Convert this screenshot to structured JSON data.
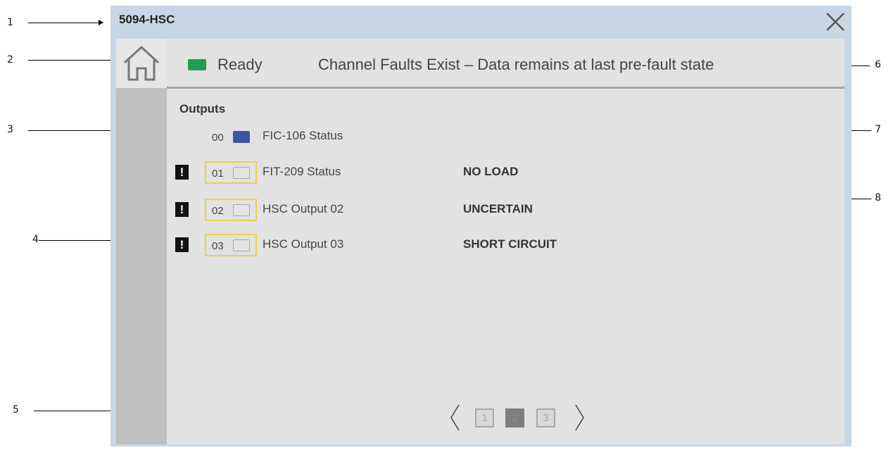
{
  "faceplate": {
    "title": "5094-HSC",
    "status": {
      "led_color": "#1f9e4f",
      "text": "Ready",
      "fault_message": "Channel Faults Exist – Data remains at last pre-fault state"
    },
    "section_label": "Outputs",
    "channels": [
      {
        "num": "00",
        "indicator_on": true,
        "label": "FIC-106 Status",
        "state": "",
        "fault": false
      },
      {
        "num": "01",
        "indicator_on": false,
        "label": "FIT-209 Status",
        "state": "NO LOAD",
        "fault": true
      },
      {
        "num": "02",
        "indicator_on": false,
        "label": "HSC Output 02",
        "state": "UNCERTAIN",
        "fault": true
      },
      {
        "num": "03",
        "indicator_on": false,
        "label": "HSC Output 03",
        "state": "SHORT CIRCUIT",
        "fault": true
      }
    ],
    "fault_icon_glyph": "!",
    "pager": {
      "pages": [
        "1",
        "2",
        "3"
      ],
      "current": "2"
    },
    "icons": {
      "close": "close-icon",
      "home": "home-icon",
      "prev": "chevron-left-icon",
      "next": "chevron-right-icon"
    },
    "colors": {
      "indicator_on": "#3d54a3",
      "fault_border": "#e8d34b",
      "frame": "#c9d6e3"
    }
  },
  "callouts": [
    "1",
    "2",
    "3",
    "4",
    "5",
    "6",
    "7",
    "8"
  ]
}
